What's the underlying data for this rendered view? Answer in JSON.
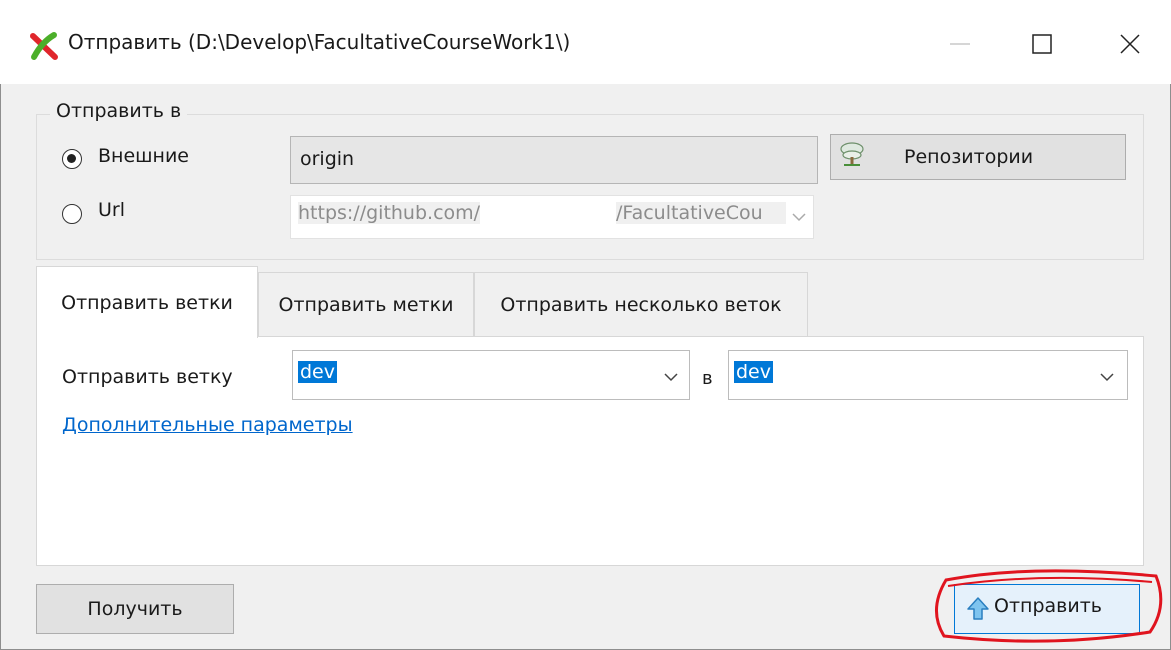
{
  "window": {
    "title": "Отправить (D:\\Develop\\FacultativeCourseWork1\\)",
    "controls": [
      "minimize-icon",
      "maximize-icon",
      "close-icon"
    ]
  },
  "push_to": {
    "group_label": "Отправить в",
    "remote_option": {
      "label": "Внешние",
      "selected": true
    },
    "url_option": {
      "label": "Url",
      "selected": false
    },
    "remote_select_value": "origin",
    "repositories_button": "Репозитории",
    "url_value_prefix": "https://github.com/",
    "url_value_suffix": "/FacultativeCou"
  },
  "tabs": [
    {
      "label": "Отправить ветки",
      "active": true
    },
    {
      "label": "Отправить метки",
      "active": false
    },
    {
      "label": "Отправить несколько веток",
      "active": false
    }
  ],
  "branch_tab": {
    "label": "Отправить ветку",
    "local_branch": "dev",
    "to_label": "в",
    "remote_branch": "dev",
    "advanced_link": "Дополнительные параметры"
  },
  "buttons": {
    "pull": "Получить",
    "push": "Отправить"
  },
  "colors": {
    "selection": "#0078d7",
    "link": "#0066cc",
    "highlight_ring": "#e0141e",
    "app_icon": [
      "#e0262c",
      "#4caf2a"
    ]
  }
}
